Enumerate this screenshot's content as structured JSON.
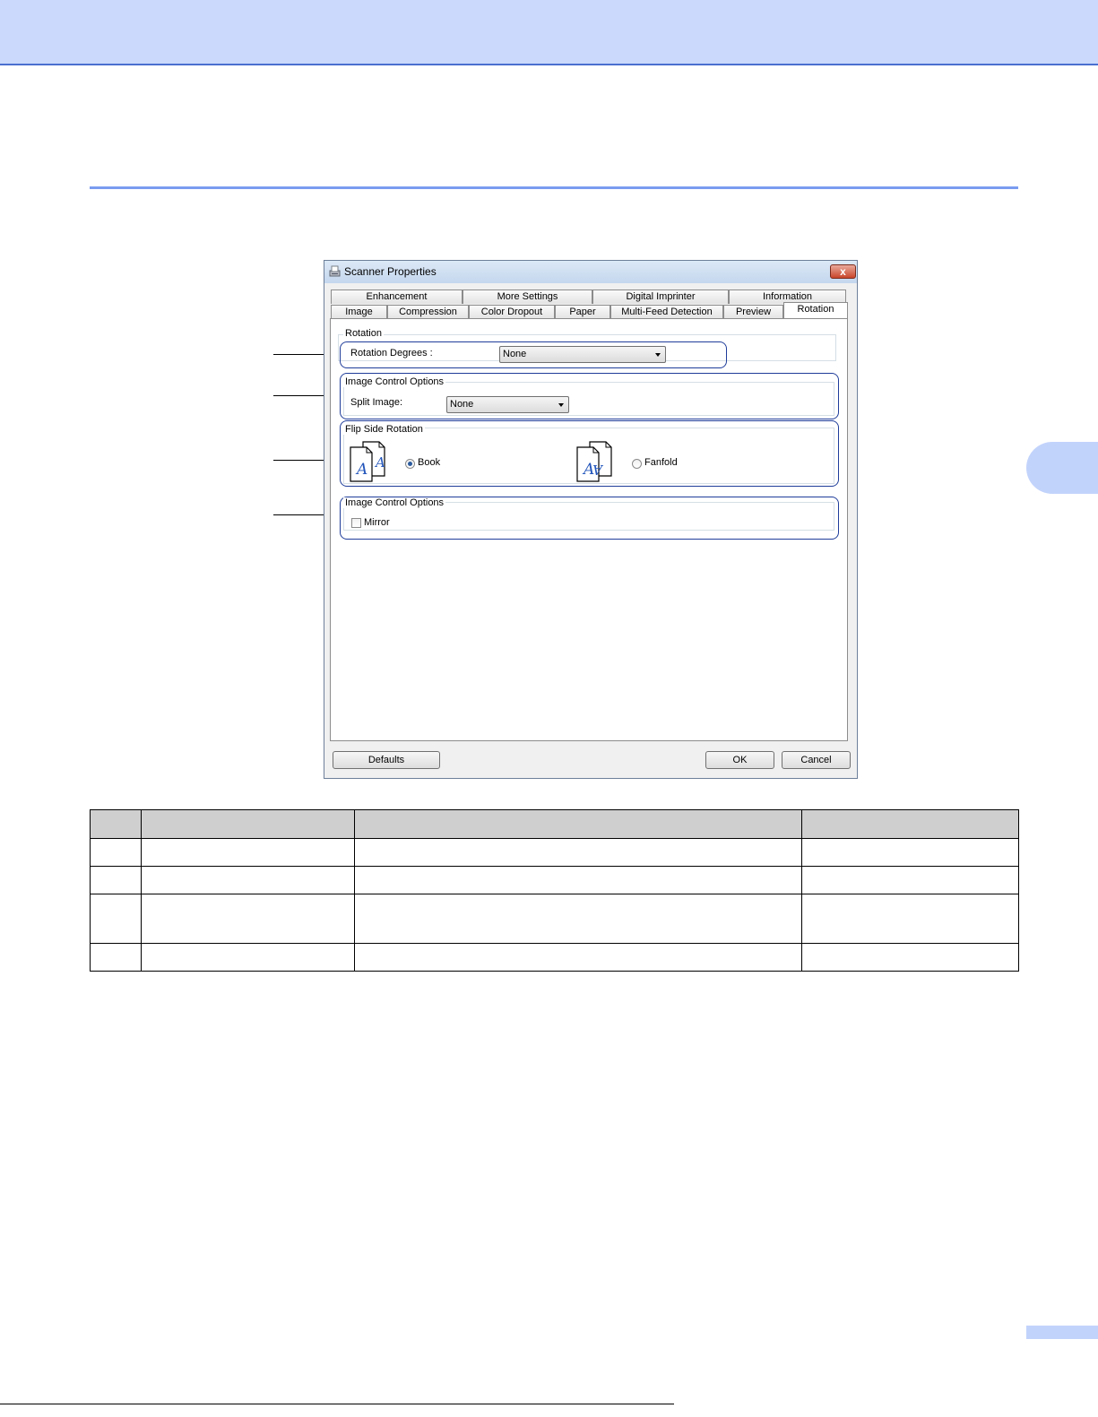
{
  "dialog": {
    "title": "Scanner Properties",
    "close_label": "x",
    "tabs_back": [
      "Enhancement",
      "More Settings",
      "Digital Imprinter",
      "Information"
    ],
    "tabs_front": [
      "Image",
      "Compression",
      "Color Dropout",
      "Paper",
      "Multi-Feed Detection",
      "Preview",
      "Rotation"
    ],
    "active_tab": "Rotation",
    "rotation_group": {
      "legend": "Rotation",
      "degrees_label": "Rotation Degrees :",
      "degrees_value": "None"
    },
    "split_group": {
      "legend": "Image Control Options",
      "split_label": "Split Image:",
      "split_value": "None"
    },
    "flip_group": {
      "legend": "Flip Side Rotation",
      "book_label": "Book",
      "fanfold_label": "Fanfold",
      "selected": "Book"
    },
    "mirror_group": {
      "legend": "Image Control Options",
      "mirror_label": "Mirror",
      "mirror_checked": false
    },
    "buttons": {
      "defaults": "Defaults",
      "ok": "OK",
      "cancel": "Cancel"
    }
  },
  "colors": {
    "header_band": "#cad9fc",
    "accent_rule": "#7a9cf0",
    "callout_frame": "#1f3d9a"
  }
}
